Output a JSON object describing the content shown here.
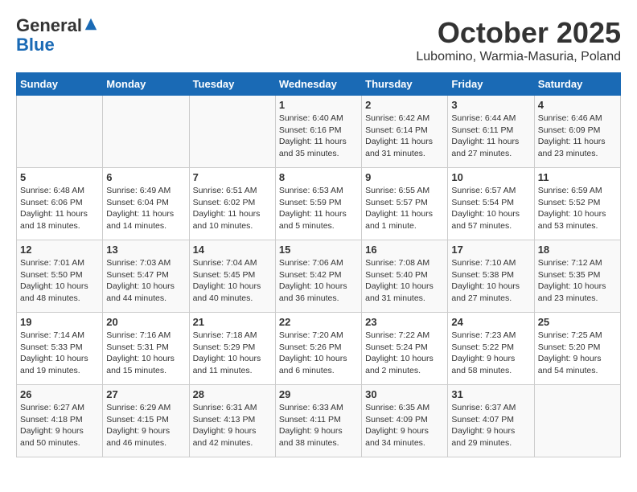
{
  "header": {
    "logo_general": "General",
    "logo_blue": "Blue",
    "month": "October 2025",
    "location": "Lubomino, Warmia-Masuria, Poland"
  },
  "weekdays": [
    "Sunday",
    "Monday",
    "Tuesday",
    "Wednesday",
    "Thursday",
    "Friday",
    "Saturday"
  ],
  "weeks": [
    [
      {
        "day": "",
        "info": ""
      },
      {
        "day": "",
        "info": ""
      },
      {
        "day": "",
        "info": ""
      },
      {
        "day": "1",
        "info": "Sunrise: 6:40 AM\nSunset: 6:16 PM\nDaylight: 11 hours\nand 35 minutes."
      },
      {
        "day": "2",
        "info": "Sunrise: 6:42 AM\nSunset: 6:14 PM\nDaylight: 11 hours\nand 31 minutes."
      },
      {
        "day": "3",
        "info": "Sunrise: 6:44 AM\nSunset: 6:11 PM\nDaylight: 11 hours\nand 27 minutes."
      },
      {
        "day": "4",
        "info": "Sunrise: 6:46 AM\nSunset: 6:09 PM\nDaylight: 11 hours\nand 23 minutes."
      }
    ],
    [
      {
        "day": "5",
        "info": "Sunrise: 6:48 AM\nSunset: 6:06 PM\nDaylight: 11 hours\nand 18 minutes."
      },
      {
        "day": "6",
        "info": "Sunrise: 6:49 AM\nSunset: 6:04 PM\nDaylight: 11 hours\nand 14 minutes."
      },
      {
        "day": "7",
        "info": "Sunrise: 6:51 AM\nSunset: 6:02 PM\nDaylight: 11 hours\nand 10 minutes."
      },
      {
        "day": "8",
        "info": "Sunrise: 6:53 AM\nSunset: 5:59 PM\nDaylight: 11 hours\nand 5 minutes."
      },
      {
        "day": "9",
        "info": "Sunrise: 6:55 AM\nSunset: 5:57 PM\nDaylight: 11 hours\nand 1 minute."
      },
      {
        "day": "10",
        "info": "Sunrise: 6:57 AM\nSunset: 5:54 PM\nDaylight: 10 hours\nand 57 minutes."
      },
      {
        "day": "11",
        "info": "Sunrise: 6:59 AM\nSunset: 5:52 PM\nDaylight: 10 hours\nand 53 minutes."
      }
    ],
    [
      {
        "day": "12",
        "info": "Sunrise: 7:01 AM\nSunset: 5:50 PM\nDaylight: 10 hours\nand 48 minutes."
      },
      {
        "day": "13",
        "info": "Sunrise: 7:03 AM\nSunset: 5:47 PM\nDaylight: 10 hours\nand 44 minutes."
      },
      {
        "day": "14",
        "info": "Sunrise: 7:04 AM\nSunset: 5:45 PM\nDaylight: 10 hours\nand 40 minutes."
      },
      {
        "day": "15",
        "info": "Sunrise: 7:06 AM\nSunset: 5:42 PM\nDaylight: 10 hours\nand 36 minutes."
      },
      {
        "day": "16",
        "info": "Sunrise: 7:08 AM\nSunset: 5:40 PM\nDaylight: 10 hours\nand 31 minutes."
      },
      {
        "day": "17",
        "info": "Sunrise: 7:10 AM\nSunset: 5:38 PM\nDaylight: 10 hours\nand 27 minutes."
      },
      {
        "day": "18",
        "info": "Sunrise: 7:12 AM\nSunset: 5:35 PM\nDaylight: 10 hours\nand 23 minutes."
      }
    ],
    [
      {
        "day": "19",
        "info": "Sunrise: 7:14 AM\nSunset: 5:33 PM\nDaylight: 10 hours\nand 19 minutes."
      },
      {
        "day": "20",
        "info": "Sunrise: 7:16 AM\nSunset: 5:31 PM\nDaylight: 10 hours\nand 15 minutes."
      },
      {
        "day": "21",
        "info": "Sunrise: 7:18 AM\nSunset: 5:29 PM\nDaylight: 10 hours\nand 11 minutes."
      },
      {
        "day": "22",
        "info": "Sunrise: 7:20 AM\nSunset: 5:26 PM\nDaylight: 10 hours\nand 6 minutes."
      },
      {
        "day": "23",
        "info": "Sunrise: 7:22 AM\nSunset: 5:24 PM\nDaylight: 10 hours\nand 2 minutes."
      },
      {
        "day": "24",
        "info": "Sunrise: 7:23 AM\nSunset: 5:22 PM\nDaylight: 9 hours\nand 58 minutes."
      },
      {
        "day": "25",
        "info": "Sunrise: 7:25 AM\nSunset: 5:20 PM\nDaylight: 9 hours\nand 54 minutes."
      }
    ],
    [
      {
        "day": "26",
        "info": "Sunrise: 6:27 AM\nSunset: 4:18 PM\nDaylight: 9 hours\nand 50 minutes."
      },
      {
        "day": "27",
        "info": "Sunrise: 6:29 AM\nSunset: 4:15 PM\nDaylight: 9 hours\nand 46 minutes."
      },
      {
        "day": "28",
        "info": "Sunrise: 6:31 AM\nSunset: 4:13 PM\nDaylight: 9 hours\nand 42 minutes."
      },
      {
        "day": "29",
        "info": "Sunrise: 6:33 AM\nSunset: 4:11 PM\nDaylight: 9 hours\nand 38 minutes."
      },
      {
        "day": "30",
        "info": "Sunrise: 6:35 AM\nSunset: 4:09 PM\nDaylight: 9 hours\nand 34 minutes."
      },
      {
        "day": "31",
        "info": "Sunrise: 6:37 AM\nSunset: 4:07 PM\nDaylight: 9 hours\nand 29 minutes."
      },
      {
        "day": "",
        "info": ""
      }
    ]
  ]
}
